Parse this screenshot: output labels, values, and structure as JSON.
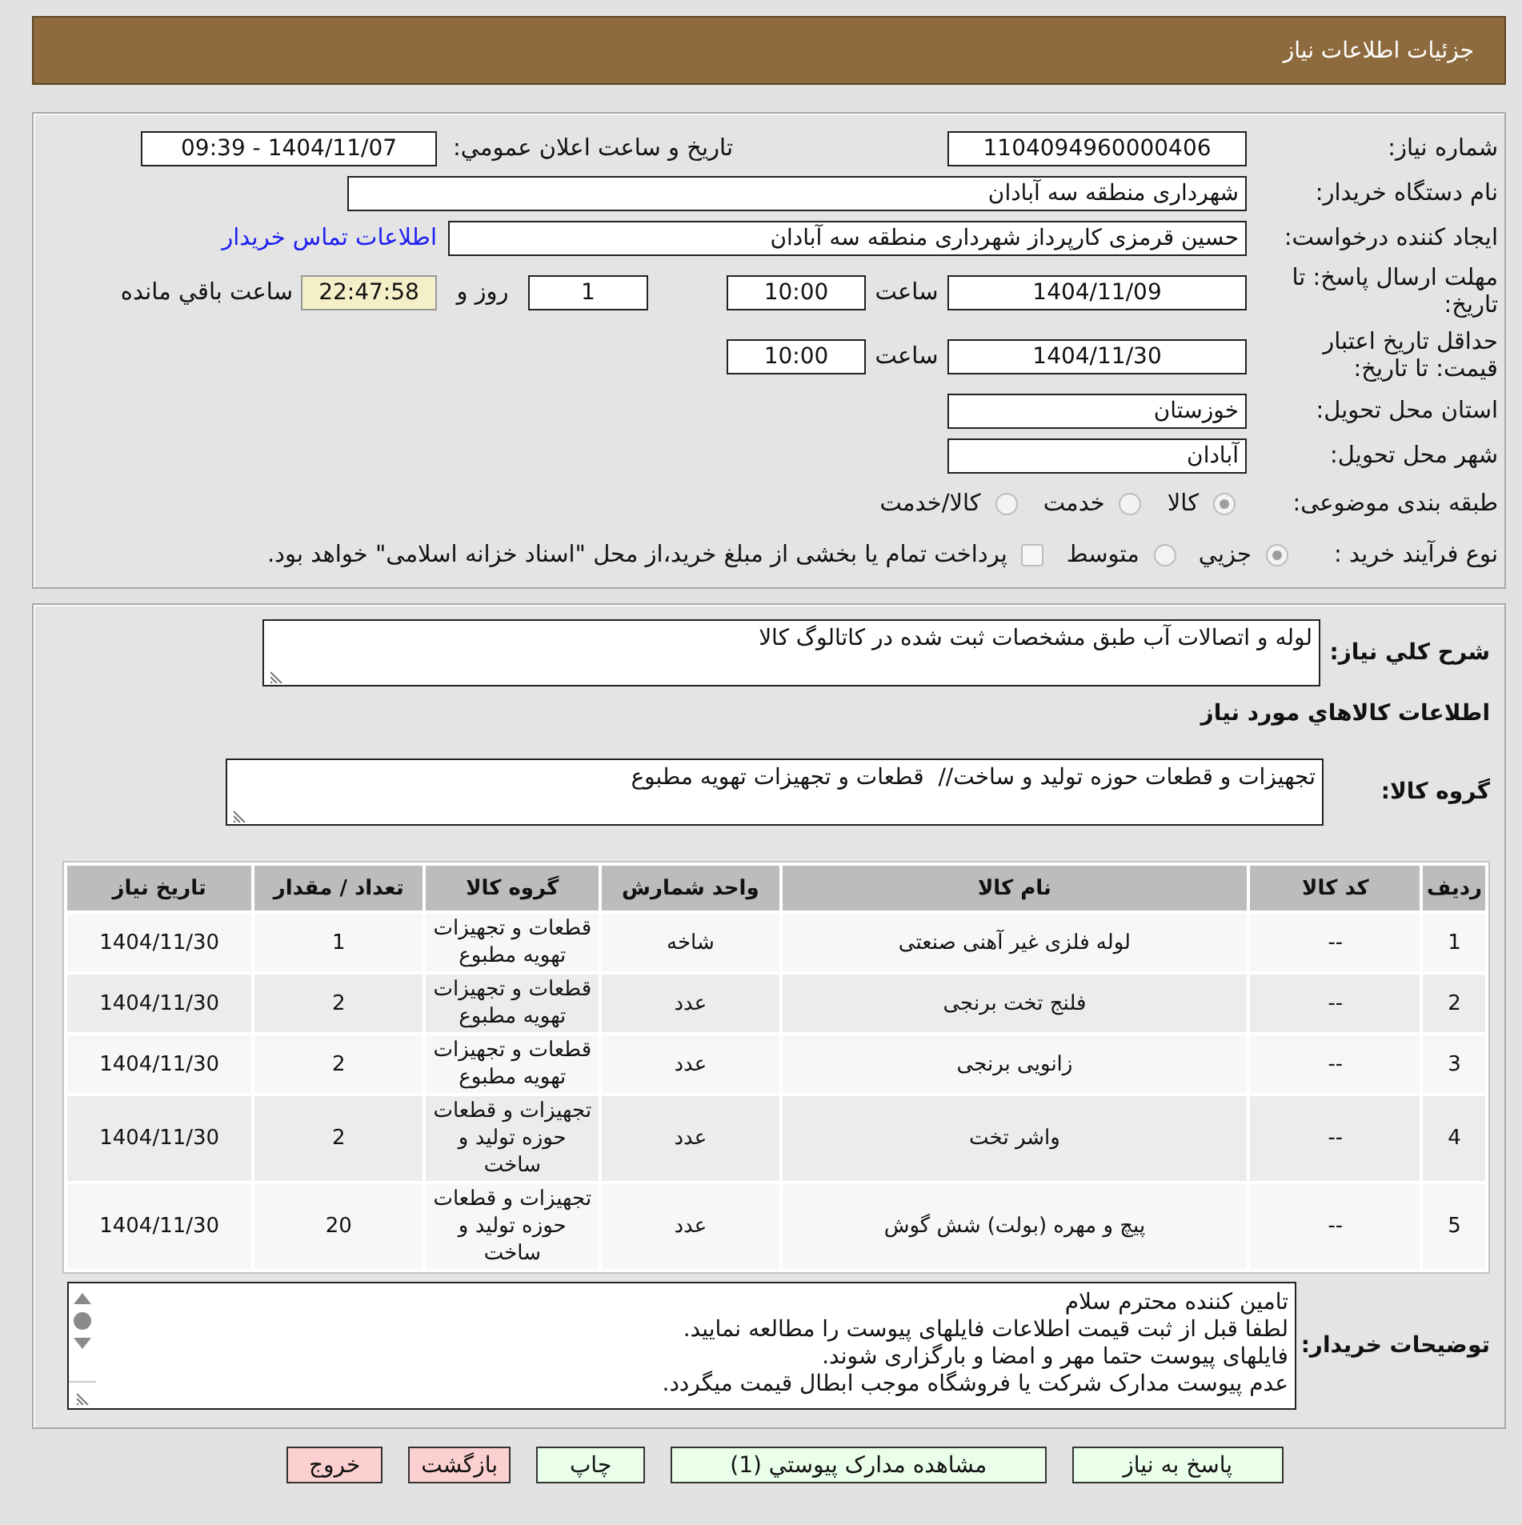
{
  "header": {
    "title": "جزئیات اطلاعات نیاز"
  },
  "details": {
    "need_number": {
      "label": "شماره نیاز:",
      "value": "1104094960000406"
    },
    "announcement": {
      "label": "تاریخ و ساعت اعلان عمومي:",
      "value": "1404/11/07 - 09:39"
    },
    "buyer_org": {
      "label": "نام دستگاه خریدار:",
      "value": "شهرداری منطقه سه آبادان"
    },
    "requester": {
      "label": "ایجاد کننده درخواست:",
      "value": "حسین قرمزی کارپرداز شهرداری منطقه سه آبادان",
      "contact_link": "اطلاعات تماس خریدار"
    },
    "response_deadline": {
      "label": "مهلت ارسال پاسخ: تا تاریخ:",
      "date": "1404/11/09",
      "time_label": "ساعت",
      "time": "10:00",
      "days": "1",
      "days_label": "روز و",
      "remaining": "22:47:58",
      "remaining_label": "ساعت باقي مانده"
    },
    "price_validity": {
      "label": "حداقل تاریخ اعتبار قیمت: تا تاریخ:",
      "date": "1404/11/30",
      "time_label": "ساعت",
      "time": "10:00"
    },
    "delivery_province": {
      "label": "استان محل تحویل:",
      "value": "خوزستان"
    },
    "delivery_city": {
      "label": "شهر محل تحویل:",
      "value": "آبادان"
    },
    "subject_category": {
      "label": "طبقه بندی موضوعی:",
      "options": [
        {
          "label": "کالا",
          "selected": true
        },
        {
          "label": "خدمت",
          "selected": false
        },
        {
          "label": "کالا/خدمت",
          "selected": false
        }
      ]
    },
    "purchase_process": {
      "label": "نوع فرآیند خرید :",
      "options": [
        {
          "label": "جزيي",
          "selected": true
        },
        {
          "label": "متوسط",
          "selected": false
        }
      ],
      "treasury_option": {
        "label": "پرداخت تمام یا بخشی از مبلغ خرید،از محل \"اسناد خزانه اسلامی\" خواهد بود.",
        "checked": false
      }
    }
  },
  "need": {
    "description": {
      "label": "شرح کلي نیاز:",
      "value": "لوله و اتصالات آب طبق مشخصات ثبت شده در کاتالوگ کالا"
    },
    "goods_heading": "اطلاعات کالاهاي مورد نیاز",
    "goods_group": {
      "label": "گروه کالا:",
      "value": "تجهیزات و قطعات حوزه تولید و ساخت//  قطعات و تجهیزات تهویه مطبوع"
    },
    "table": {
      "columns": [
        "ردیف",
        "کد کالا",
        "نام کالا",
        "واحد شمارش",
        "گروه کالا",
        "تعداد / مقدار",
        "تاریخ نیاز"
      ],
      "rows": [
        [
          "1",
          "--",
          "لوله فلزی غیر آهنی صنعتی",
          "شاخه",
          "قطعات و تجهیزات تهویه مطبوع",
          "1",
          "1404/11/30"
        ],
        [
          "2",
          "--",
          "فلنج تخت برنجی",
          "عدد",
          "قطعات و تجهیزات تهویه مطبوع",
          "2",
          "1404/11/30"
        ],
        [
          "3",
          "--",
          "زانویی برنجی",
          "عدد",
          "قطعات و تجهیزات تهویه مطبوع",
          "2",
          "1404/11/30"
        ],
        [
          "4",
          "--",
          "واشر تخت",
          "عدد",
          "تجهیزات و قطعات حوزه تولید و ساخت",
          "2",
          "1404/11/30"
        ],
        [
          "5",
          "--",
          "پیچ و مهره (بولت) شش گوش",
          "عدد",
          "تجهیزات و قطعات حوزه تولید و ساخت",
          "20",
          "1404/11/30"
        ]
      ]
    }
  },
  "buyer_notes": {
    "label": "توضیحات خریدار:",
    "value": "تامین کننده محترم سلام\nلطفا قبل از ثبت قیمت اطلاعات فایلهای پیوست را مطالعه نمایید.\nفایلهای پیوست حتما مهر و امضا و بارگزاری شوند.\nعدم پیوست مدارک شرکت یا فروشگاه موجب ابطال قیمت میگردد."
  },
  "buttons": [
    {
      "label": "پاسخ به نیاز",
      "kind": "reply"
    },
    {
      "label": "مشاهده مدارک پیوستي (1)",
      "kind": "attachments"
    },
    {
      "label": "چاپ",
      "kind": "print"
    },
    {
      "label": "بازگشت",
      "kind": "back"
    },
    {
      "label": "خروج",
      "kind": "exit"
    }
  ]
}
